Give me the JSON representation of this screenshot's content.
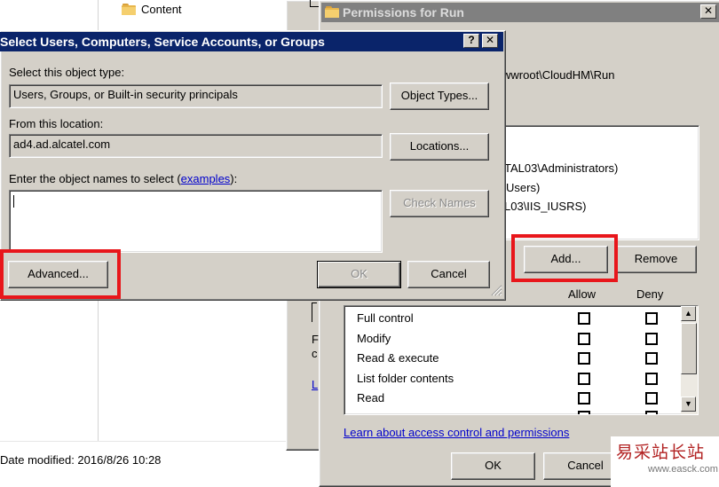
{
  "explorer": {
    "folder_label": "Content",
    "status_date": "Date modified: 2016/8/26 10:28"
  },
  "permissions": {
    "title": "Permissions for Run",
    "object_path": "wwroot\\CloudHM\\Run",
    "principals": [
      "TAL03\\Administrators)",
      "Users)",
      "L03\\IIS_IUSRS)"
    ],
    "add_label": "Add...",
    "remove_label": "Remove",
    "col_allow": "Allow",
    "col_deny": "Deny",
    "rows": [
      "Full control",
      "Modify",
      "Read & execute",
      "List folder contents",
      "Read"
    ],
    "hidden_fragments": [
      "F",
      "c",
      "L"
    ],
    "learn_link": "Learn about access control and permissions",
    "ok_label": "OK",
    "cancel_label": "Cancel"
  },
  "select_dialog": {
    "title": "Select Users, Computers, Service Accounts, or Groups",
    "help_btn": "?",
    "close_btn": "✕",
    "object_type_label": "Select this object type:",
    "object_type_value": "Users, Groups, or Built-in security principals",
    "object_types_btn": "Object Types...",
    "location_label": "From this location:",
    "location_value": "ad4.ad.alcatel.com",
    "locations_btn": "Locations...",
    "names_label_prefix": "Enter the object names to select (",
    "names_label_link": "examples",
    "names_label_suffix": "):",
    "names_value": "",
    "check_names_btn": "Check Names",
    "advanced_btn": "Advanced...",
    "ok_btn": "OK",
    "cancel_btn": "Cancel"
  },
  "watermark": {
    "text": "易采站长站",
    "url": "www.easck.com"
  },
  "colors": {
    "highlight_red": "#e8161b",
    "title_active": "#0a246a",
    "title_inactive": "#808080"
  }
}
